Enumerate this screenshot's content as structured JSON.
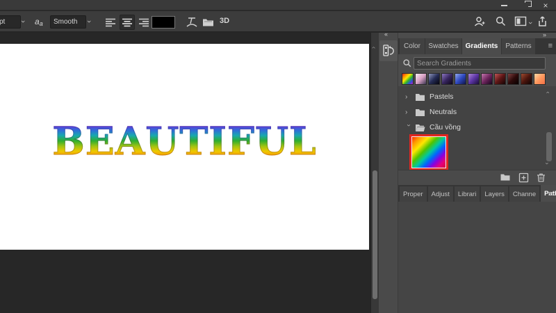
{
  "icons": {
    "chevron": "›",
    "double_chevron_left": "«",
    "double_chevron_right": "»",
    "menu_glyph": "≡",
    "close_glyph": "×"
  },
  "options_bar": {
    "font_size_value": "pt",
    "anti_alias_a1": "a",
    "anti_alias_a2": "a",
    "smoothing_value": "Smooth",
    "text_color": "#000000",
    "three_d_label": "3D"
  },
  "canvas": {
    "text": "BEAUTIFUL"
  },
  "gradients_panel": {
    "tabs": [
      {
        "label": "Color",
        "active": false
      },
      {
        "label": "Swatches",
        "active": false
      },
      {
        "label": "Gradients",
        "active": true
      },
      {
        "label": "Patterns",
        "active": false
      }
    ],
    "search_placeholder": "Search Gradients",
    "presets": [
      {
        "name": "rainbow",
        "css": "linear-gradient(135deg,#ff1a1a,#ff8c00,#ffe600,#2fb52f,#2f4fd8,#c41ac4)"
      },
      {
        "name": "pink-fade",
        "css": "linear-gradient(135deg,#f7ecf2,#d9a0c4,#3a3550)"
      },
      {
        "name": "navy",
        "css": "linear-gradient(135deg,#8f97bd,#252c55,#05050f)"
      },
      {
        "name": "deep-purple",
        "css": "linear-gradient(135deg,#8d77c2,#37265f,#0d0618)"
      },
      {
        "name": "blue",
        "css": "linear-gradient(135deg,#93a9ea,#2f49c0,#0f1448)"
      },
      {
        "name": "violet",
        "css": "linear-gradient(135deg,#ad85d6,#5c35a4,#1c0d3a)"
      },
      {
        "name": "plum",
        "css": "linear-gradient(135deg,#c477ae,#6d255c,#16051d)"
      },
      {
        "name": "crimson",
        "css": "linear-gradient(135deg,#bf5555,#5c1616,#150303)"
      },
      {
        "name": "ember",
        "css": "linear-gradient(135deg,#7e4040,#2e0b0b,#070000)"
      },
      {
        "name": "maroon",
        "css": "linear-gradient(135deg,#9e4a30,#4b150d,#0e0302)"
      },
      {
        "name": "peach",
        "css": "linear-gradient(135deg,#ffd9a6,#ff9a5f,#f36f45)"
      }
    ],
    "groups": [
      {
        "name": "Pastels",
        "expanded": false
      },
      {
        "name": "Neutrals",
        "expanded": false
      },
      {
        "name": "Cầu vồng",
        "expanded": true
      }
    ],
    "selected_gradient": {
      "name": "rainbow-diagonal",
      "selection_color": "#e3261f",
      "css": "linear-gradient(135deg,#ff2a00 0%,#ff9500 12%,#ffe600 26%,#4fc400 40%,#00c8a0 52%,#0064ff 64%,#8800e0 76%,#e6007a 88%,#d40040 100%)"
    }
  },
  "bottom_panel": {
    "tabs": [
      {
        "label": "Proper",
        "active": false
      },
      {
        "label": "Adjust",
        "active": false
      },
      {
        "label": "Librari",
        "active": false
      },
      {
        "label": "Layers",
        "active": false
      },
      {
        "label": "Channe",
        "active": false
      },
      {
        "label": "Paths",
        "active": true
      }
    ]
  }
}
